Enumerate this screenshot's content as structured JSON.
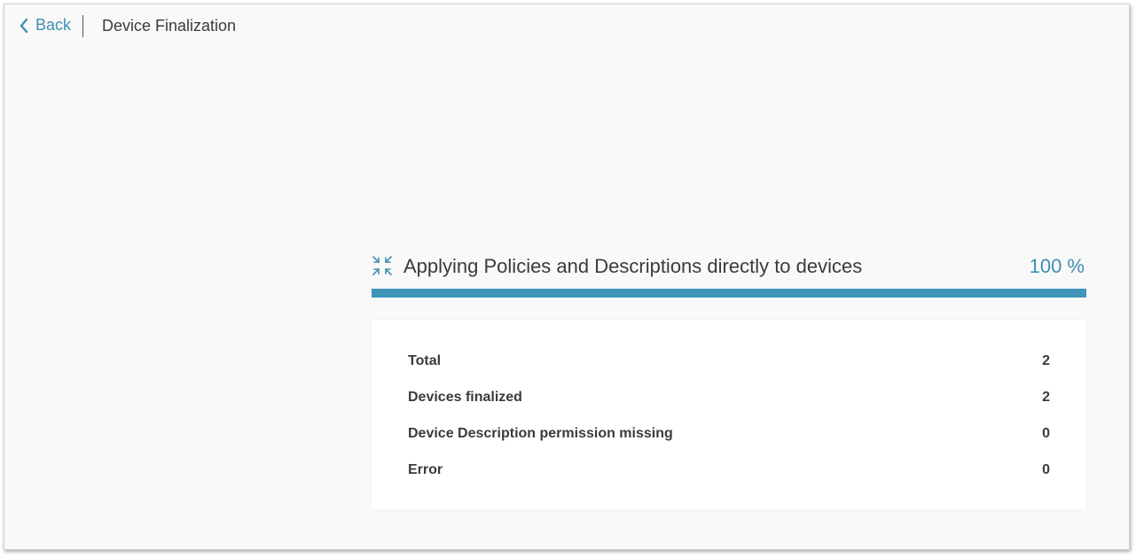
{
  "header": {
    "back_label": "Back",
    "title": "Device Finalization"
  },
  "progress": {
    "label": "Applying Policies and Descriptions directly to devices",
    "percent_text": "100 %",
    "value": 100,
    "icon": "compress-icon"
  },
  "stats": [
    {
      "label": "Total",
      "value": "2"
    },
    {
      "label": "Devices finalized",
      "value": "2"
    },
    {
      "label": "Device Description permission missing",
      "value": "0"
    },
    {
      "label": "Error",
      "value": "0"
    }
  ],
  "colors": {
    "accent": "#3f95b8",
    "text": "#3b3b3b",
    "background": "#f9f9f9",
    "card": "#ffffff"
  }
}
